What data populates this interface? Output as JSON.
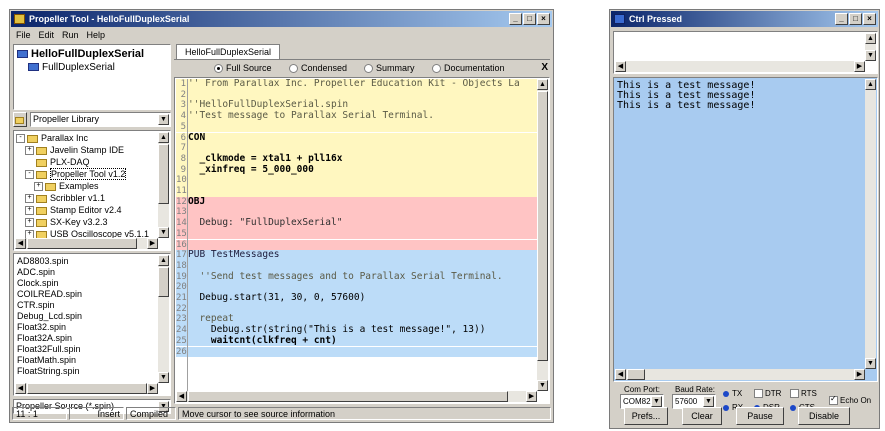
{
  "left_window": {
    "title": "Propeller Tool - HelloFullDuplexSerial",
    "menu": [
      "File",
      "Edit",
      "Run",
      "Help"
    ],
    "object_tree": {
      "root": "HelloFullDuplexSerial",
      "child": "FullDuplexSerial"
    },
    "library_combo": "Propeller Library",
    "folder_tree": [
      {
        "label": "Parallax Inc",
        "expander": "-",
        "indent": 0
      },
      {
        "label": "Javelin Stamp IDE",
        "expander": "+",
        "indent": 1
      },
      {
        "label": "PLX-DAQ",
        "expander": "",
        "indent": 1
      },
      {
        "label": "Propeller Tool v1.2",
        "expander": "-",
        "indent": 1,
        "selected": true
      },
      {
        "label": "Examples",
        "expander": "+",
        "indent": 2
      },
      {
        "label": "Scribbler v1.1",
        "expander": "+",
        "indent": 1
      },
      {
        "label": "Stamp Editor v2.4",
        "expander": "+",
        "indent": 1
      },
      {
        "label": "SX-Key v3.2.3",
        "expander": "+",
        "indent": 1
      },
      {
        "label": "USB Oscilloscope v5.1.1",
        "expander": "+",
        "indent": 1
      }
    ],
    "files": [
      "AD8803.spin",
      "ADC.spin",
      "Clock.spin",
      "COILREAD.spin",
      "CTR.spin",
      "Debug_Lcd.spin",
      "Float32.spin",
      "Float32A.spin",
      "Float32Full.spin",
      "FloatMath.spin",
      "FloatString.spin"
    ],
    "filter_combo": "Propeller Source (*.spin)",
    "tab_label": "HelloFullDuplexSerial",
    "view_modes": [
      "Full Source",
      "Condensed",
      "Summary",
      "Documentation"
    ],
    "view_selected": "Full Source",
    "close_glyph": "X",
    "code_lines": [
      {
        "n": "1",
        "text": "'' From Parallax Inc. Propeller Education Kit - Objects La",
        "block": "con",
        "style": "cmt"
      },
      {
        "n": "2",
        "text": "",
        "block": "con",
        "style": ""
      },
      {
        "n": "3",
        "text": "''HelloFullDuplexSerial.spin",
        "block": "con",
        "style": "cmt"
      },
      {
        "n": "4",
        "text": "''Test message to Parallax Serial Terminal.",
        "block": "con",
        "style": "cmt"
      },
      {
        "n": "5",
        "text": "",
        "block": "con",
        "style": ""
      },
      {
        "n": "6",
        "text": "CON",
        "block": "con",
        "style": "k"
      },
      {
        "n": "7",
        "text": "",
        "block": "con",
        "style": ""
      },
      {
        "n": "8",
        "text": "  _clkmode = xtal1 + pll16x",
        "block": "con",
        "style": "k"
      },
      {
        "n": "9",
        "text": "  _xinfreq = 5_000_000",
        "block": "con",
        "style": "xin"
      },
      {
        "n": "10",
        "text": "",
        "block": "con",
        "style": ""
      },
      {
        "n": "11",
        "text": "",
        "block": "con",
        "style": ""
      },
      {
        "n": "12",
        "text": "OBJ",
        "block": "obj",
        "style": "k"
      },
      {
        "n": "13",
        "text": "",
        "block": "obj",
        "style": ""
      },
      {
        "n": "14",
        "text": "  Debug: \"FullDuplexSerial\"",
        "block": "obj",
        "style": "objline"
      },
      {
        "n": "15",
        "text": "",
        "block": "obj",
        "style": ""
      },
      {
        "n": "16",
        "text": "",
        "block": "obj",
        "style": ""
      },
      {
        "n": "17",
        "text": "PUB TestMessages",
        "block": "pub",
        "style": "pub"
      },
      {
        "n": "18",
        "text": "",
        "block": "pub",
        "style": ""
      },
      {
        "n": "19",
        "text": "  ''Send test messages and to Parallax Serial Terminal.",
        "block": "pub",
        "style": "cmt"
      },
      {
        "n": "20",
        "text": "",
        "block": "pub",
        "style": ""
      },
      {
        "n": "21",
        "text": "  Debug.start(31, 30, 0, 57600)",
        "block": "pub",
        "style": "start"
      },
      {
        "n": "22",
        "text": "",
        "block": "pub",
        "style": ""
      },
      {
        "n": "23",
        "text": "  repeat",
        "block": "pub",
        "style": "cmt"
      },
      {
        "n": "24",
        "text": "    Debug.str(string(\"This is a test message!\", 13))",
        "block": "pub",
        "style": "strline"
      },
      {
        "n": "25",
        "text": "    waitcnt(clkfreq + cnt)",
        "block": "pub",
        "style": "k"
      },
      {
        "n": "26",
        "text": "",
        "block": "pub",
        "style": ""
      }
    ],
    "status": {
      "position": "11 : 1",
      "mode": "Insert",
      "compiled": "Compiled",
      "hint": "Move cursor to see source information"
    }
  },
  "right_window": {
    "title": "Ctrl Pressed",
    "terminal_lines": [
      "This is a test message!",
      "This is a test message!",
      "This is a test message!"
    ],
    "com_port_label": "Com Port:",
    "com_port": "COM82",
    "baud_label": "Baud Rate:",
    "baud": "57600",
    "indicators": {
      "tx": "TX",
      "rx": "RX",
      "dtr": "DTR",
      "dsr": "DSR",
      "rts": "RTS",
      "cts": "CTS"
    },
    "echo": "Echo On",
    "buttons": {
      "prefs": "Prefs...",
      "clear": "Clear",
      "pause": "Pause",
      "disable": "Disable"
    }
  },
  "colors": {
    "con_bg": "#fff7c0",
    "obj_bg": "#ffc4c4",
    "pub_bg": "#bcdcf8",
    "terminal_bg": "#a8cbf0",
    "title_start": "#0a246a",
    "title_end": "#a6caf0"
  }
}
